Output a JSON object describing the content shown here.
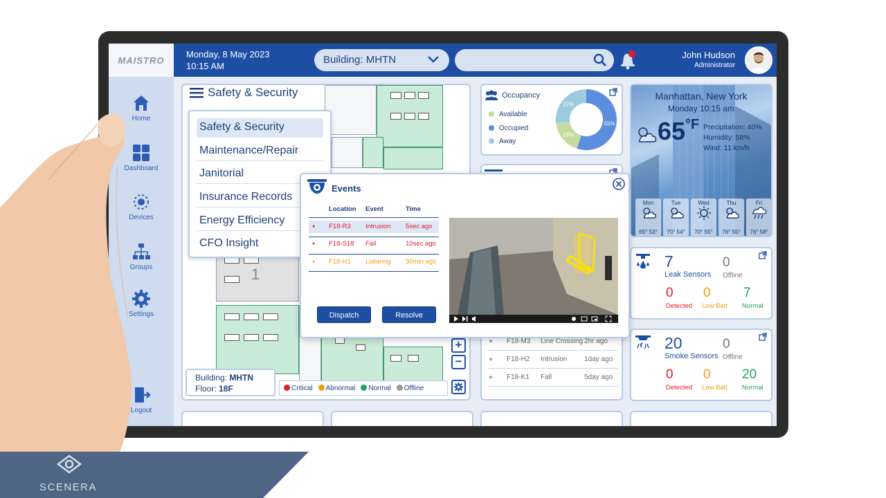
{
  "app": {
    "logo_text": "MAISTRO"
  },
  "sidebar": {
    "items": [
      {
        "label": "Home",
        "icon": "home-icon"
      },
      {
        "label": "Dashboard",
        "icon": "dashboard-icon"
      },
      {
        "label": "Devices",
        "icon": "devices-icon"
      },
      {
        "label": "Groups",
        "icon": "groups-icon"
      },
      {
        "label": "Settings",
        "icon": "settings-icon"
      },
      {
        "label": "Logout",
        "icon": "logout-icon"
      }
    ]
  },
  "header": {
    "date": "Monday, 8 May 2023",
    "time": "10:15 AM",
    "building_select": "Building: MHTN",
    "search_placeholder": "",
    "notification_dot_color": "#e8182b",
    "user_name": "John Hudson",
    "user_role": "Administrator"
  },
  "floor_panel": {
    "title": "Safety & Security",
    "menu": [
      {
        "label": "Safety & Security",
        "active": true
      },
      {
        "label": "Maintenance/Repair"
      },
      {
        "label": "Janitorial"
      },
      {
        "label": "Insurance Records"
      },
      {
        "label": "Energy Efficiency"
      },
      {
        "label": "CFO Insight"
      }
    ],
    "room_number": "1",
    "building_label": "Building:",
    "building_value": "MHTN",
    "floor_label": "Floor:",
    "floor_value": "18F",
    "legend": [
      {
        "label": "Critical",
        "color": "#e8182b"
      },
      {
        "label": "Abnormal",
        "color": "#f39c12"
      },
      {
        "label": "Normal",
        "color": "#1fa35b"
      },
      {
        "label": "Offline",
        "color": "#999999"
      }
    ],
    "zoom_in": "+",
    "zoom_out": "−"
  },
  "occupancy": {
    "title": "Occupancy",
    "legend": [
      {
        "label": "Available",
        "color": "#c6dba0"
      },
      {
        "label": "Occupied",
        "color": "#5b8ede"
      },
      {
        "label": "Away",
        "color": "#9ccbe0"
      }
    ],
    "slices": [
      {
        "label": "Occupied",
        "value": 55,
        "color": "#5b8ede",
        "text": "55%"
      },
      {
        "label": "Available",
        "value": 18,
        "color": "#c6dba0",
        "text": "18%"
      },
      {
        "label": "Away",
        "value": 27,
        "color": "#9ccbe0",
        "text": "27%"
      }
    ]
  },
  "weather": {
    "city": "Manhattan, New York",
    "time": "Monday 10:15 am",
    "temp": "65",
    "unit": "°F",
    "precipitation": "Precipitation: 40%",
    "humidity": "Humidity: 58%",
    "wind": "Wind: 11 km/h",
    "forecast": [
      {
        "day": "Mon",
        "temps": "65° 53°",
        "icon": "cloud-sun-icon"
      },
      {
        "day": "Tue",
        "temps": "70° 54°",
        "icon": "cloud-sun-icon"
      },
      {
        "day": "Wed",
        "temps": "70° 55°",
        "icon": "sun-icon"
      },
      {
        "day": "Thu",
        "temps": "76° 55°",
        "icon": "cloud-sun-icon"
      },
      {
        "day": "Fri",
        "temps": "76° 58°",
        "icon": "rain-icon"
      }
    ]
  },
  "leak": {
    "count": "7",
    "label": "Leak Sensors",
    "offline": "0",
    "offline_label": "Offline",
    "detected": "0",
    "detected_label": "Detected",
    "lowbatt": "0",
    "lowbatt_label": "Low Batt",
    "normal": "7",
    "normal_label": "Normal"
  },
  "smoke": {
    "count": "20",
    "label": "Smoke Sensors",
    "offline": "0",
    "offline_label": "Offline",
    "detected": "0",
    "detected_label": "Detected",
    "lowbatt": "0",
    "lowbatt_label": "Low Batt",
    "normal": "20",
    "normal_label": "Normal"
  },
  "alerts": [
    {
      "loc": "F18-M3",
      "event": "Line Crossing",
      "time": "2hr ago"
    },
    {
      "loc": "F18-H2",
      "event": "Intrusion",
      "time": "1day ago"
    },
    {
      "loc": "F18-K1",
      "event": "Fall",
      "time": "5day ago"
    }
  ],
  "events": {
    "title": "Events",
    "headers": {
      "location": "Location",
      "event": "Event",
      "time": "Time"
    },
    "rows": [
      {
        "loc": "F18-R3",
        "event": "Intrusion",
        "time": "5sec ago",
        "color": "#e8182b"
      },
      {
        "loc": "F18-S18",
        "event": "Fall",
        "time": "10sec ago",
        "color": "#e8182b"
      },
      {
        "loc": "F18-H1",
        "event": "Loitering",
        "time": "30min ago",
        "color": "#f39c12"
      }
    ],
    "dispatch": "Dispatch",
    "resolve": "Resolve"
  },
  "brand": {
    "name": "SCENERA"
  }
}
